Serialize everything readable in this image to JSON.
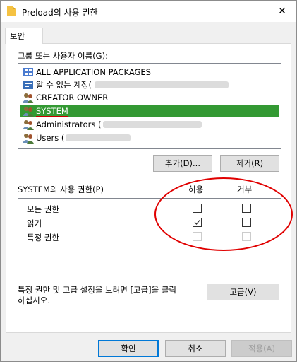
{
  "window": {
    "title": "Preload의 사용 권한",
    "close_label": "✕"
  },
  "tabs": [
    {
      "label": "보안"
    }
  ],
  "groups": {
    "label": "그룹 또는 사용자 이름(G):",
    "items": [
      {
        "label": "ALL APPLICATION PACKAGES",
        "icon": "packages-icon"
      },
      {
        "label": "알 수 없는 계정(",
        "icon": "unknown-account-icon"
      },
      {
        "label": "CREATOR OWNER",
        "icon": "users-icon"
      },
      {
        "label": "SYSTEM",
        "icon": "users-icon"
      },
      {
        "label": "Administrators (",
        "icon": "users-icon"
      },
      {
        "label": "Users (",
        "icon": "users-icon"
      }
    ],
    "selected": "SYSTEM"
  },
  "buttons": {
    "add": "추가(D)...",
    "remove": "제거(R)",
    "advanced": "고급(V)",
    "ok": "확인",
    "cancel": "취소",
    "apply": "적용(A)"
  },
  "permissions": {
    "label": "SYSTEM의 사용 권한(P)",
    "allow_header": "허용",
    "deny_header": "거부",
    "rows": [
      {
        "name": "모든 권한",
        "allow": false,
        "deny": false,
        "enabled": true
      },
      {
        "name": "읽기",
        "allow": true,
        "deny": false,
        "enabled": true
      },
      {
        "name": "특정 권한",
        "allow": false,
        "deny": false,
        "enabled": false
      }
    ]
  },
  "advanced_text": {
    "line1": "특정 권한 및 고급 설정을 보려면 [고급]을 클릭",
    "line2": "하십시오."
  },
  "colors": {
    "selection": "#339933",
    "annotation": "#e00000",
    "default_button_border": "#0078d7"
  }
}
